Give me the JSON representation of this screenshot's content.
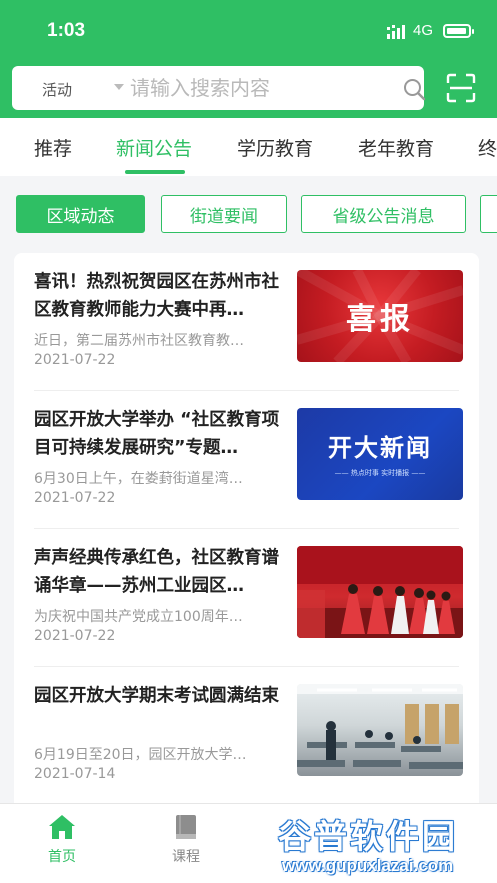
{
  "status_bar": {
    "time": "1:03",
    "network": "4G"
  },
  "search": {
    "category": "活动",
    "placeholder": "请输入搜索内容"
  },
  "tabs": [
    {
      "label": "推荐",
      "active": false
    },
    {
      "label": "新闻公告",
      "active": true
    },
    {
      "label": "学历教育",
      "active": false
    },
    {
      "label": "老年教育",
      "active": false
    },
    {
      "label": "终",
      "active": false
    }
  ],
  "filters": [
    {
      "label": "区域动态",
      "active": true
    },
    {
      "label": "街道要闻",
      "active": false
    },
    {
      "label": "省级公告消息",
      "active": false
    }
  ],
  "news": [
    {
      "title": "喜讯！热烈祝贺园区在苏州市社区教育教师能力大赛中再…",
      "summary": "近日，第二届苏州市社区教育教…",
      "date": "2021-07-22",
      "thumb_text": "喜报"
    },
    {
      "title": "园区开放大学举办 “社区教育项目可持续发展研究”专题…",
      "summary": "6月30日上午，在娄葑街道星湾…",
      "date": "2021-07-22",
      "thumb_text": "开大新闻",
      "thumb_subtext": "—— 热点时事 实时播报 ——"
    },
    {
      "title": "声声经典传承红色，社区教育谱诵华章——苏州工业园区…",
      "summary": "为庆祝中国共产党成立100周年…",
      "date": "2021-07-22"
    },
    {
      "title": "园区开放大学期末考试圆满结束",
      "summary": "6月19日至20日，园区开放大学…",
      "date": "2021-07-14"
    }
  ],
  "bottom_nav": [
    {
      "label": "首页",
      "icon": "home-icon",
      "active": true
    },
    {
      "label": "课程",
      "icon": "book-icon",
      "active": false
    }
  ],
  "watermark": {
    "main": "谷普软件园",
    "url": "www.gupuxlazai.com"
  },
  "colors": {
    "brand": "#2fbf64",
    "text": "#222222",
    "muted": "#999999"
  }
}
